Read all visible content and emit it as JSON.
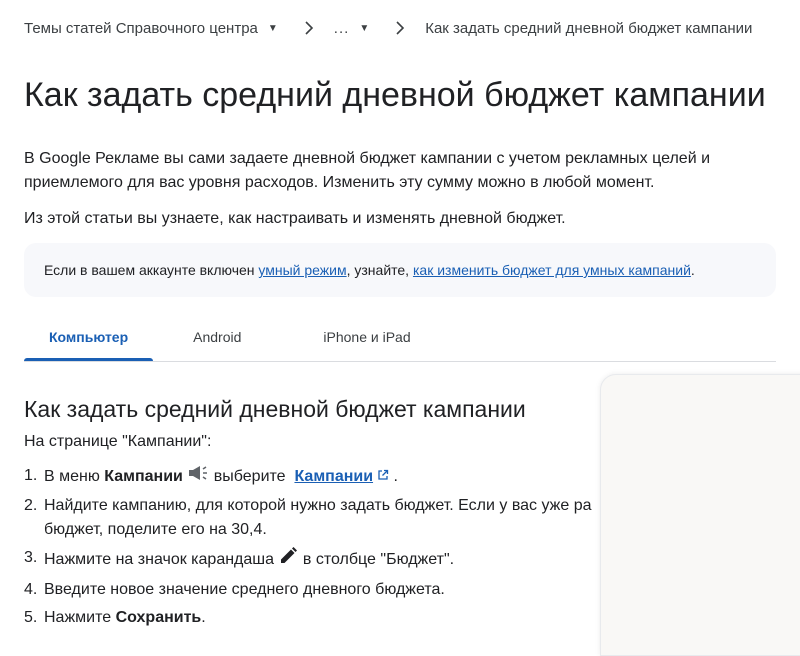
{
  "breadcrumb": {
    "items": [
      "Темы статей Справочного центра",
      "...",
      "Как задать средний дневной бюджет кампании"
    ]
  },
  "page": {
    "title": "Как задать средний дневной бюджет кампании",
    "intro": "В Google Рекламе вы сами задаете дневной бюджет кампании с учетом рекламных целей и приемлемого для вас уровня расходов. Изменить эту сумму можно в любой момент.",
    "intro2": "Из этой статьи вы узнаете, как настраивать и изменять дневной бюджет."
  },
  "callout": {
    "prefix": "Если в вашем аккаунте включен ",
    "link1": "умный режим",
    "middle": ", узнайте, ",
    "link2": "как изменить бюджет для умных кампаний",
    "suffix": "."
  },
  "tabs": [
    {
      "label": "Компьютер",
      "active": true
    },
    {
      "label": "Android",
      "active": false
    },
    {
      "label": "iPhone и iPad",
      "active": false
    }
  ],
  "section": {
    "title": "Как задать средний дневной бюджет кампании",
    "lead": "На странице \"Кампании\":"
  },
  "steps": {
    "s1": {
      "num": "1.",
      "a": "В меню ",
      "b": "Кампании",
      "c": " выберите ",
      "link": "Кампании",
      "d": " ."
    },
    "s2": {
      "num": "2.",
      "text": "Найдите кампанию, для которой нужно задать бюджет. Если у вас уже ра",
      "text2": "бюджет, поделите его на 30,4."
    },
    "s3": {
      "num": "3.",
      "a": "Нажмите на значок карандаша ",
      "b": " в столбце \"Бюджет\"."
    },
    "s4": {
      "num": "4.",
      "text": "Введите новое значение среднего дневного бюджета."
    },
    "s5": {
      "num": "5.",
      "a": "Нажмите ",
      "b": "Сохранить",
      "c": "."
    }
  },
  "colors": {
    "accent": "#1a5fb4",
    "text": "#202124",
    "callout_bg": "#f7f8fb"
  },
  "icons": [
    "chevron-down-icon",
    "chevron-right-icon",
    "megaphone-icon",
    "external-link-icon",
    "pencil-icon"
  ]
}
